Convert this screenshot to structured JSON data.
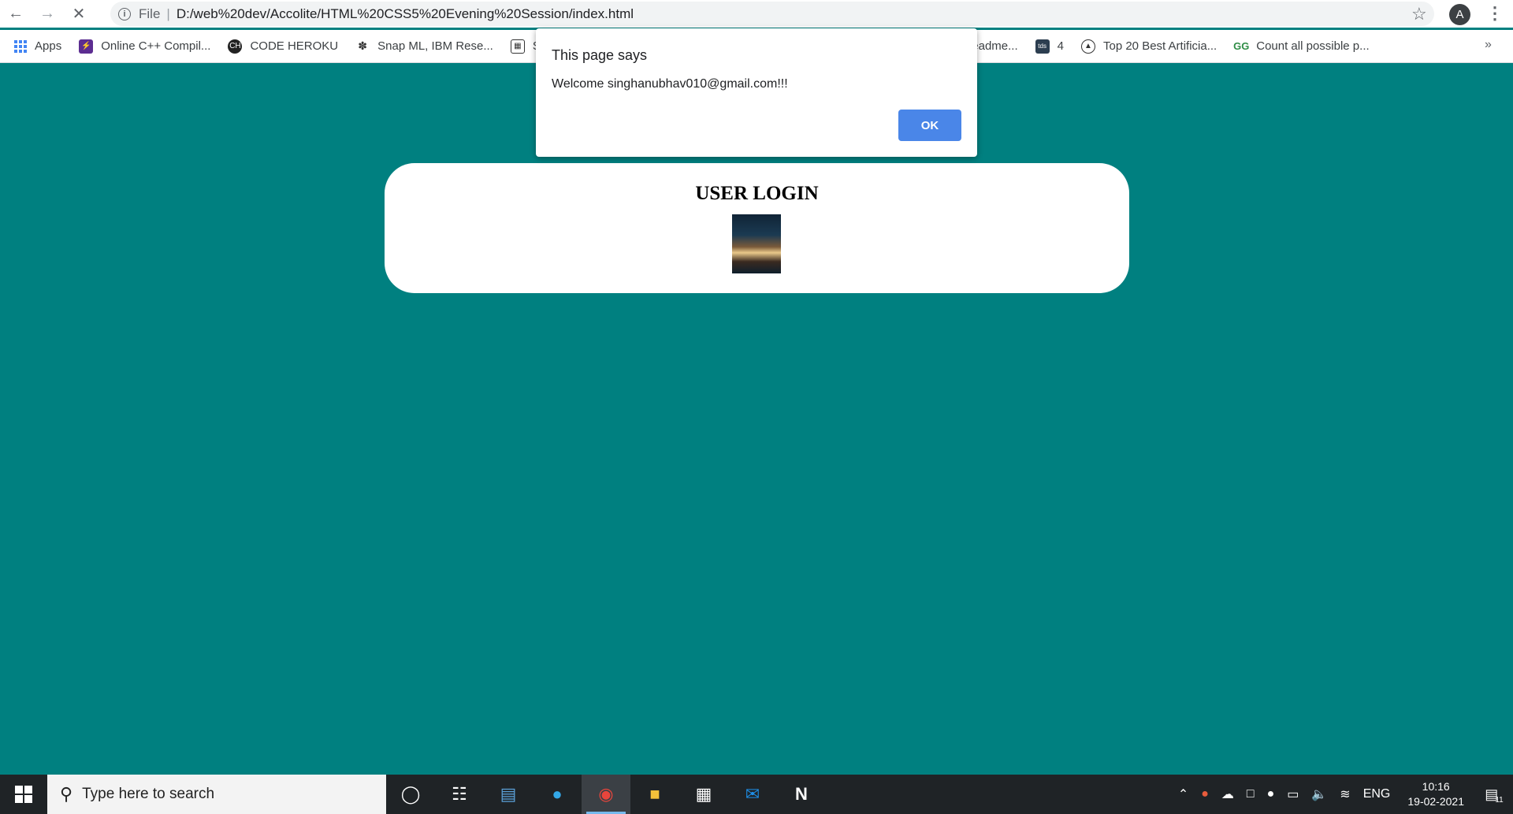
{
  "browser": {
    "url_scheme_label": "File",
    "url": "D:/web%20dev/Accolite/HTML%20CSS5%20Evening%20Session/index.html",
    "profile_initial": "A",
    "bookmarks": [
      {
        "label": "Apps"
      },
      {
        "label": "Online C++ Compil..."
      },
      {
        "label": "CODE HEROKU"
      },
      {
        "label": "Snap ML, IBM Rese..."
      },
      {
        "label": "Sc"
      },
      {
        "label": "hackathons/readme..."
      },
      {
        "label": "4"
      },
      {
        "label": "Top 20 Best Artificia..."
      },
      {
        "label": "Count all possible p..."
      }
    ]
  },
  "dialog": {
    "title": "This page says",
    "message": "Welcome singhanubhav010@gmail.com!!!",
    "ok_label": "OK"
  },
  "page": {
    "login_title": "USER LOGIN"
  },
  "taskbar": {
    "search_placeholder": "Type here to search",
    "language": "ENG",
    "time": "10:16",
    "date": "19-02-2021",
    "notification_count": "11"
  }
}
